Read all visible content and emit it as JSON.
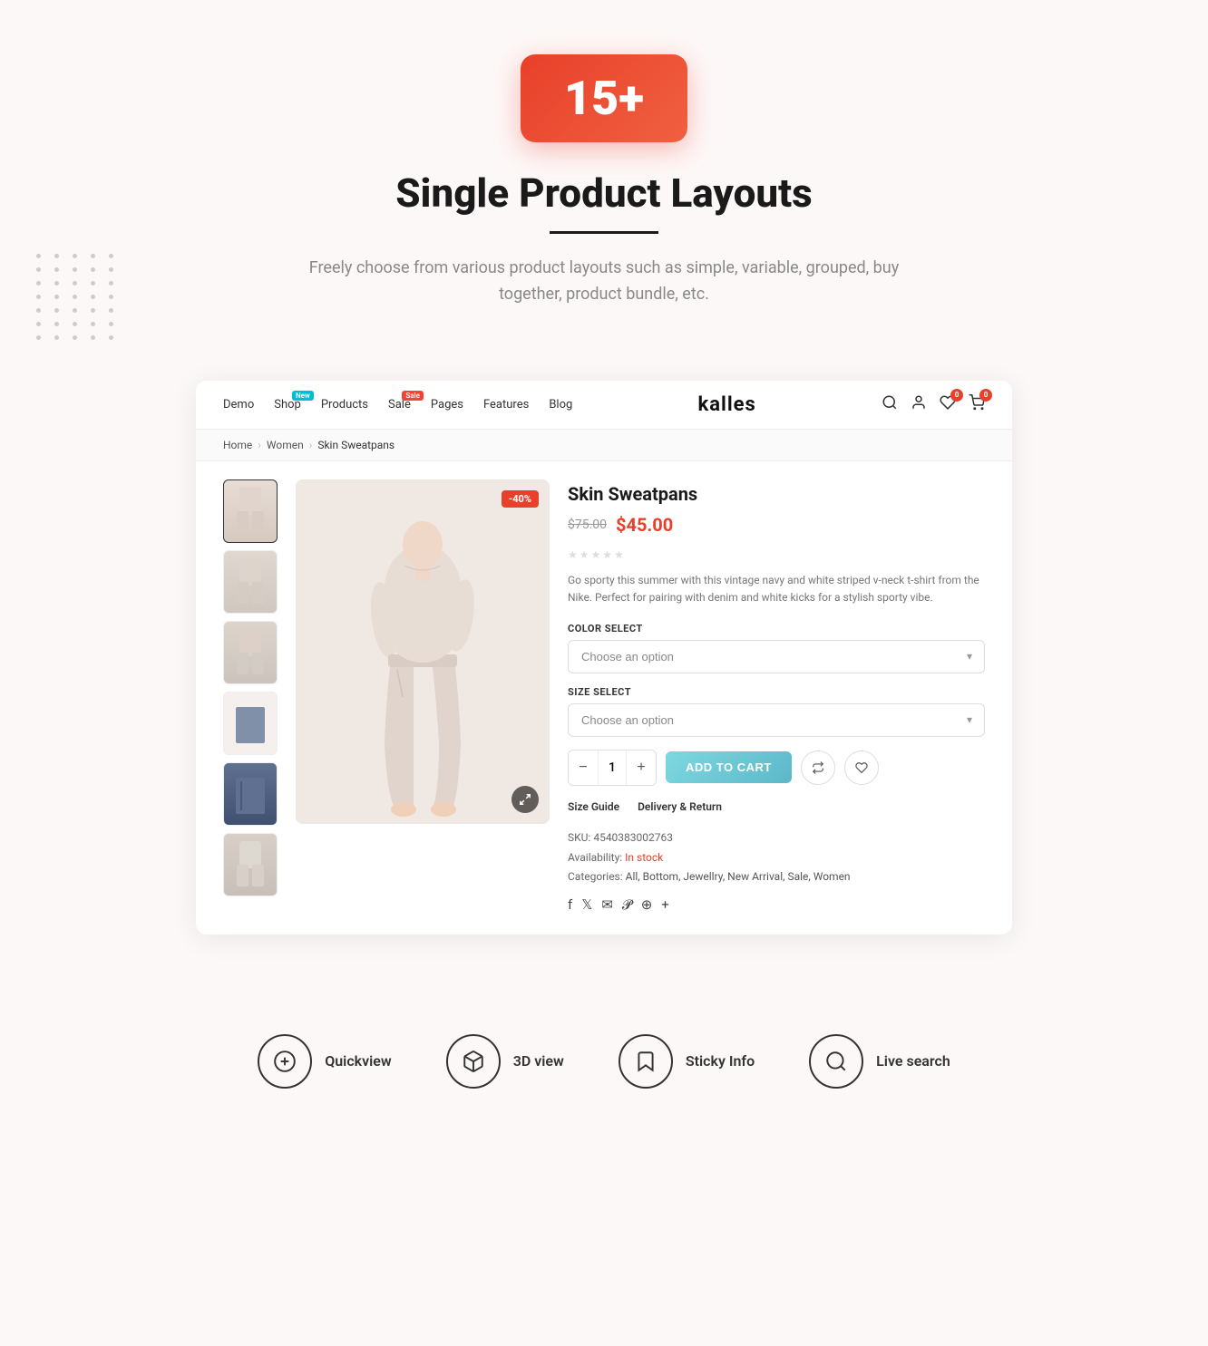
{
  "badge": {
    "value": "15+"
  },
  "hero": {
    "title": "Single Product Layouts",
    "subtitle": "Freely choose from various product layouts such as simple, variable, grouped, buy together, product bundle, etc."
  },
  "nav": {
    "links": [
      "Demo",
      "Shop",
      "Products",
      "Sale",
      "Pages",
      "Features",
      "Blog"
    ],
    "badges": {
      "Shop": "New",
      "Sale": "Sale"
    },
    "logo": "kalles",
    "wishlist_count": "0",
    "cart_count": "0"
  },
  "breadcrumb": {
    "home": "Home",
    "category": "Women",
    "product": "Skin Sweatpans"
  },
  "product": {
    "title": "Skin Sweatpans",
    "price_original": "$75.00",
    "price_sale": "$45.00",
    "discount": "-40%",
    "description": "Go sporty this summer with this vintage navy and white striped v-neck t-shirt from the Nike. Perfect for pairing with denim and white kicks for a stylish sporty vibe.",
    "color_label": "COLOR SELECT",
    "color_placeholder": "Choose an option",
    "size_label": "SIZE SELECT",
    "size_placeholder": "Choose an option",
    "qty": "1",
    "add_to_cart": "ADD TO CART",
    "size_guide": "Size Guide",
    "delivery_return": "Delivery & Return",
    "sku_label": "SKU:",
    "sku_value": "4540383002763",
    "availability_label": "Availability:",
    "availability_value": "In stock",
    "categories_label": "Categories:",
    "categories_value": "All, Bottom, Jewellry, New Arrival, Sale, Women"
  },
  "features": [
    {
      "icon": "plus-circle",
      "label": "Quickview"
    },
    {
      "icon": "box-3d",
      "label": "3D view"
    },
    {
      "icon": "bookmark",
      "label": "Sticky Info"
    },
    {
      "icon": "search",
      "label": "Live search"
    }
  ]
}
